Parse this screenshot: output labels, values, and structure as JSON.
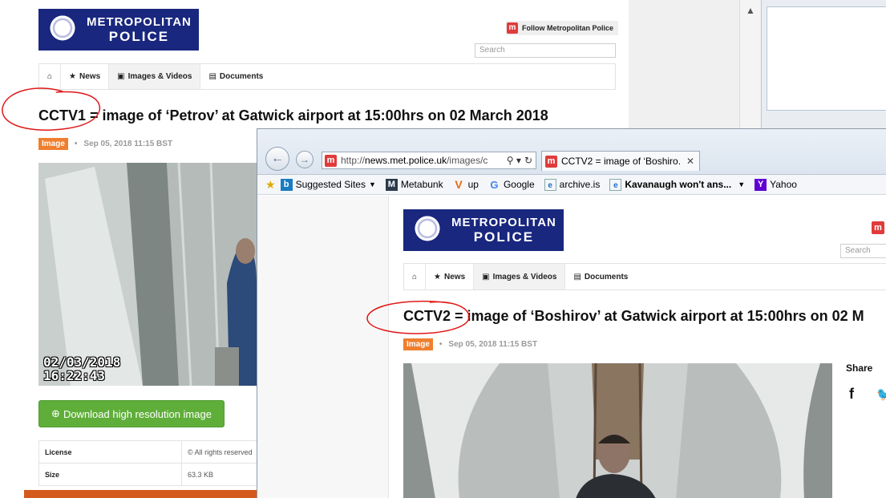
{
  "back_page": {
    "logo_line1": "METROPOLITAN",
    "logo_line2": "POLICE",
    "follow_label": "Follow Metropolitan Police",
    "search_placeholder": "Search",
    "nav": {
      "home_icon": "⌂",
      "news": "News",
      "images_videos": "Images & Videos",
      "documents": "Documents"
    },
    "title_prefix": "CCTV1",
    "title_rest": " = image of ‘Petrov’ at Gatwick airport at 15:00hrs on 02 March 2018",
    "tag": "Image",
    "date": "Sep 05, 2018 11:15 BST",
    "cctv_date": "02/03/2018",
    "cctv_time": "16:22:43",
    "download_label": "Download high resolution image",
    "table": [
      {
        "key": "License",
        "value": "© All rights reserved"
      },
      {
        "key": "Size",
        "value": "63.3 KB"
      }
    ]
  },
  "browser": {
    "address_prefix": "http://",
    "address_domain": "news.met.police.uk",
    "address_suffix": "/images/c",
    "tab_title": "CCTV2 = image of ‘Boshiro...",
    "favorites": [
      {
        "label": "Suggested Sites",
        "icon": "bing-icon",
        "dropdown": true
      },
      {
        "label": "Metabunk",
        "icon": "metabunk-icon"
      },
      {
        "label": "up",
        "icon": "v-icon"
      },
      {
        "label": "Google",
        "icon": "google-icon"
      },
      {
        "label": "archive.is",
        "icon": "ie-page-icon"
      },
      {
        "label": "Kavanaugh won't ans...",
        "icon": "ie-page-icon",
        "dropdown": true
      },
      {
        "label": "Yahoo",
        "icon": "yahoo-icon"
      }
    ]
  },
  "front_page": {
    "logo_line1": "METROPOLITAN",
    "logo_line2": "POLICE",
    "search_placeholder": "Search",
    "nav": {
      "news": "News",
      "images_videos": "Images & Videos",
      "documents": "Documents"
    },
    "title_prefix": "CCTV2",
    "title_rest": " = image of ‘Boshirov’ at Gatwick airport at 15:00hrs on 02 M",
    "tag": "Image",
    "date": "Sep 05, 2018 11:15 BST",
    "share_label": "Share"
  },
  "colors": {
    "met_blue": "#19277e",
    "annotation_red": "#e01818",
    "tag_orange": "#ef7f2e",
    "download_green": "#5fae3a"
  }
}
